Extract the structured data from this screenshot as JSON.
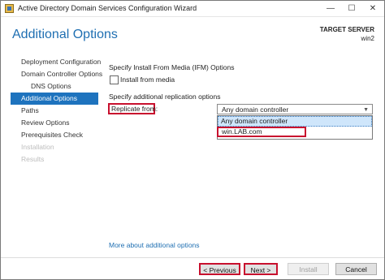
{
  "window": {
    "title": "Active Directory Domain Services Configuration Wizard",
    "controls": {
      "minimize": "—",
      "maximize": "☐",
      "close": "✕"
    }
  },
  "header": {
    "page_title": "Additional Options",
    "target_label": "TARGET SERVER",
    "target_value": "win2"
  },
  "nav": {
    "items": [
      {
        "label": "Deployment Configuration",
        "state": "normal"
      },
      {
        "label": "Domain Controller Options",
        "state": "normal"
      },
      {
        "label": "DNS Options",
        "state": "normal"
      },
      {
        "label": "Additional Options",
        "state": "active"
      },
      {
        "label": "Paths",
        "state": "normal"
      },
      {
        "label": "Review Options",
        "state": "normal"
      },
      {
        "label": "Prerequisites Check",
        "state": "normal"
      },
      {
        "label": "Installation",
        "state": "disabled"
      },
      {
        "label": "Results",
        "state": "disabled"
      }
    ]
  },
  "main": {
    "ifm_heading": "Specify Install From Media (IFM) Options",
    "ifm_checkbox_label": "Install from media",
    "ifm_checked": false,
    "replication_heading": "Specify additional replication options",
    "replicate_label": "Replicate from:",
    "replicate_selected": "Any domain controller",
    "replicate_options": [
      "Any domain controller",
      "win.LAB.com"
    ],
    "more_link": "More about additional options"
  },
  "footer": {
    "previous": "< Previous",
    "next": "Next >",
    "install": "Install",
    "cancel": "Cancel"
  },
  "colors": {
    "accent": "#1e73be",
    "title_blue": "#1f6fb2",
    "highlight_red": "#c8102e"
  }
}
